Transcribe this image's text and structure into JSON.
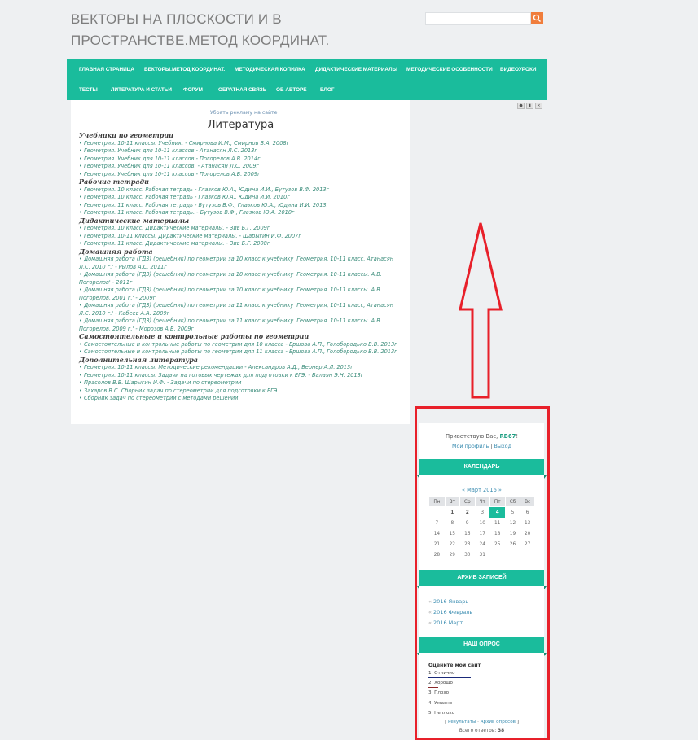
{
  "site": {
    "title": "ВЕКТОРЫ НА ПЛОСКОСТИ И В ПРОСТРАНСТВЕ.МЕТОД КООРДИНАТ."
  },
  "colors": {
    "accent": "#1abc9c",
    "search_button": "#f07d3c",
    "highlight_border": "#e8202a",
    "link": "#3a8c7a"
  },
  "nav": {
    "row1": [
      "ГЛАВНАЯ СТРАНИЦА",
      "ВЕКТОРЫ.МЕТОД КООРДИНАТ.",
      "МЕТОДИЧЕСКАЯ КОПИЛКА",
      "ДИДАКТИЧЕСКИЕ МАТЕРИАЛЫ",
      "МЕТОДИЧЕСКИЕ ОСОБЕННОСТИ",
      "ВИДЕОУРОКИ"
    ],
    "row2": [
      "ТЕСТЫ",
      "ЛИТЕРАТУРА И СТАТЬИ",
      "ФОРУМ",
      "ОБРАТНАЯ СВЯЗЬ",
      "ОБ АВТОРЕ",
      "БЛОГ"
    ]
  },
  "content": {
    "remove_ad": "Убрать рекламу на сайте",
    "title": "Литература",
    "sections": [
      {
        "heading": "Учебники по геометрии",
        "items": [
          "Геометрия. 10-11 классы. Учебник. - Смирнова И.М., Смирнов В.А. 2008г",
          "Геометрия. Учебник для 10-11 классов - Атанасян Л.С. 2013г",
          "Геометрия. Учебник для 10-11 классов - Погорелов А.В. 2014г",
          "Геометрия. Учебник для 10-11 классов. - Атанасян Л.С. 2009г",
          "Геометрия. Учебник для 10-11 классов - Погорелов А.В. 2009г"
        ]
      },
      {
        "heading": "Рабочие тетради",
        "items": [
          "Геометрия. 10 класс. Рабочая тетрадь - Глазков Ю.А., Юдина И.И., Бутузов В.Ф. 2013г",
          "Геометрия. 10 класс. Рабочая тетрадь - Глазков Ю.А., Юдина И.И. 2010г",
          "Геометрия. 11 класс. Рабочая тетрадь - Бутузов В.Ф., Глазков Ю.А., Юдина И.И. 2013г",
          "Геометрия. 11 класс. Рабочая тетрадь. - Бутузов В.Ф., Глазков Ю.А. 2010г"
        ]
      },
      {
        "heading": "Дидактические материалы",
        "items": [
          "Геометрия. 10 класс. Дидактические материалы. - Зив Б.Г. 2009г",
          "Геометрия. 10-11 классы. Дидактические материалы. - Шарыгин И.Ф. 2007г",
          "Геометрия. 11 класс. Дидактические материалы. - Зив Б.Г. 2008г"
        ]
      },
      {
        "heading": "Домашняя работа",
        "items": [
          "Домашняя работа (ГДЗ) (решебник) по геометрии за 10 класс к учебнику 'Геометрия, 10-11 класс, Атанасян Л.С. 2010 г.' - Рылов А.С. 2011г",
          "Домашняя работа (ГДЗ) (решебник) по геометрии за 10 класс к учебнику 'Геометрия. 10-11 классы. А.В. Погорелов' - 2011г",
          "Домашняя работа (ГДЗ) (решебник) по геометрии за 10 класс к учебнику 'Геометрия. 10-11 классы. А.В. Погорелов, 2001 г.' - 2009г",
          "Домашняя работа (ГДЗ) (решебник) по геометрии за 11 класс к учебнику 'Геометрия, 10-11 класс, Атанасян Л.С. 2010 г.' - Кабеев А.А. 2009г",
          "Домашняя работа (ГДЗ) (решебник) по геометрии за 11 класс к учебнику 'Геометрия. 10-11 классы. А.В. Погорелов, 2009 г.' - Морозов А.В. 2009г"
        ]
      },
      {
        "heading": "Самостоятельные и контрольные работы по геометрии",
        "items": [
          "Самостоятельные и контрольные работы по геометрии для 10 класса - Ершова А.П., Голобородько В.В. 2013г",
          "Самостоятельные и контрольные работы по геометрии для 11 класса - Ершова А.П., Голобородько В.В. 2013г"
        ]
      },
      {
        "heading": "Дополнительная литература",
        "items": [
          "Геометрия. 10-11 классы. Методические рекомендации - Александров А.Д., Вернер А.Л. 2013г",
          "Геометрия. 10-11 классы. Задачи на готовых чертежах для подготовки к ЕГЭ. - Балаян Э.Н. 2013г",
          "Прасолов В.В. Шарыгин И.Ф. - Задачи по стереометрии",
          "Захаров В.С. Сборник задач по стереометрии для подготовки к ЕГЭ",
          "Сборник задач по стереометрии с методами решений"
        ]
      }
    ]
  },
  "sidebar": {
    "greeting_prefix": "Приветствую Вас, ",
    "username": "RB67",
    "greeting_suffix": "!",
    "profile_link": "Мой профиль",
    "separator": "|",
    "logout_link": "Выход",
    "calendar": {
      "header": "КАЛЕНДАРЬ",
      "prev": "«",
      "month": "Март 2016",
      "next": "»",
      "weekdays": [
        "Пн",
        "Вт",
        "Ср",
        "Чт",
        "Пт",
        "Сб",
        "Вс"
      ],
      "weeks": [
        [
          "",
          "1",
          "2",
          "3",
          "4",
          "5",
          "6"
        ],
        [
          "7",
          "8",
          "9",
          "10",
          "11",
          "12",
          "13"
        ],
        [
          "14",
          "15",
          "16",
          "17",
          "18",
          "19",
          "20"
        ],
        [
          "21",
          "22",
          "23",
          "24",
          "25",
          "26",
          "27"
        ],
        [
          "28",
          "29",
          "30",
          "31",
          "",
          "",
          ""
        ]
      ],
      "today": "4",
      "linked_days": [
        "1",
        "2"
      ]
    },
    "archive": {
      "header": "АРХИВ ЗАПИСЕЙ",
      "items": [
        "2016 Январь",
        "2016 Февраль",
        "2016 Март"
      ]
    },
    "poll": {
      "header": "НАШ ОПРОС",
      "question": "Оцените мой сайт",
      "options": [
        {
          "label": "1. Отлично",
          "bar_color": "#1a2a7a",
          "share": 1.0
        },
        {
          "label": "2. Хорошо",
          "bar_color": "#8b2a2a",
          "share": 0.24
        },
        {
          "label": "3. Плохо",
          "bar_color": "",
          "share": 0
        },
        {
          "label": "4. Ужасно",
          "bar_color": "",
          "share": 0
        },
        {
          "label": "5. Неплохо",
          "bar_color": "",
          "share": 0
        }
      ],
      "links_open": "[",
      "results_link": "Результаты",
      "links_sep": "·",
      "archive_link": "Архив опросов",
      "links_close": "]",
      "total_label": "Всего ответов:",
      "total_value": "38"
    }
  }
}
